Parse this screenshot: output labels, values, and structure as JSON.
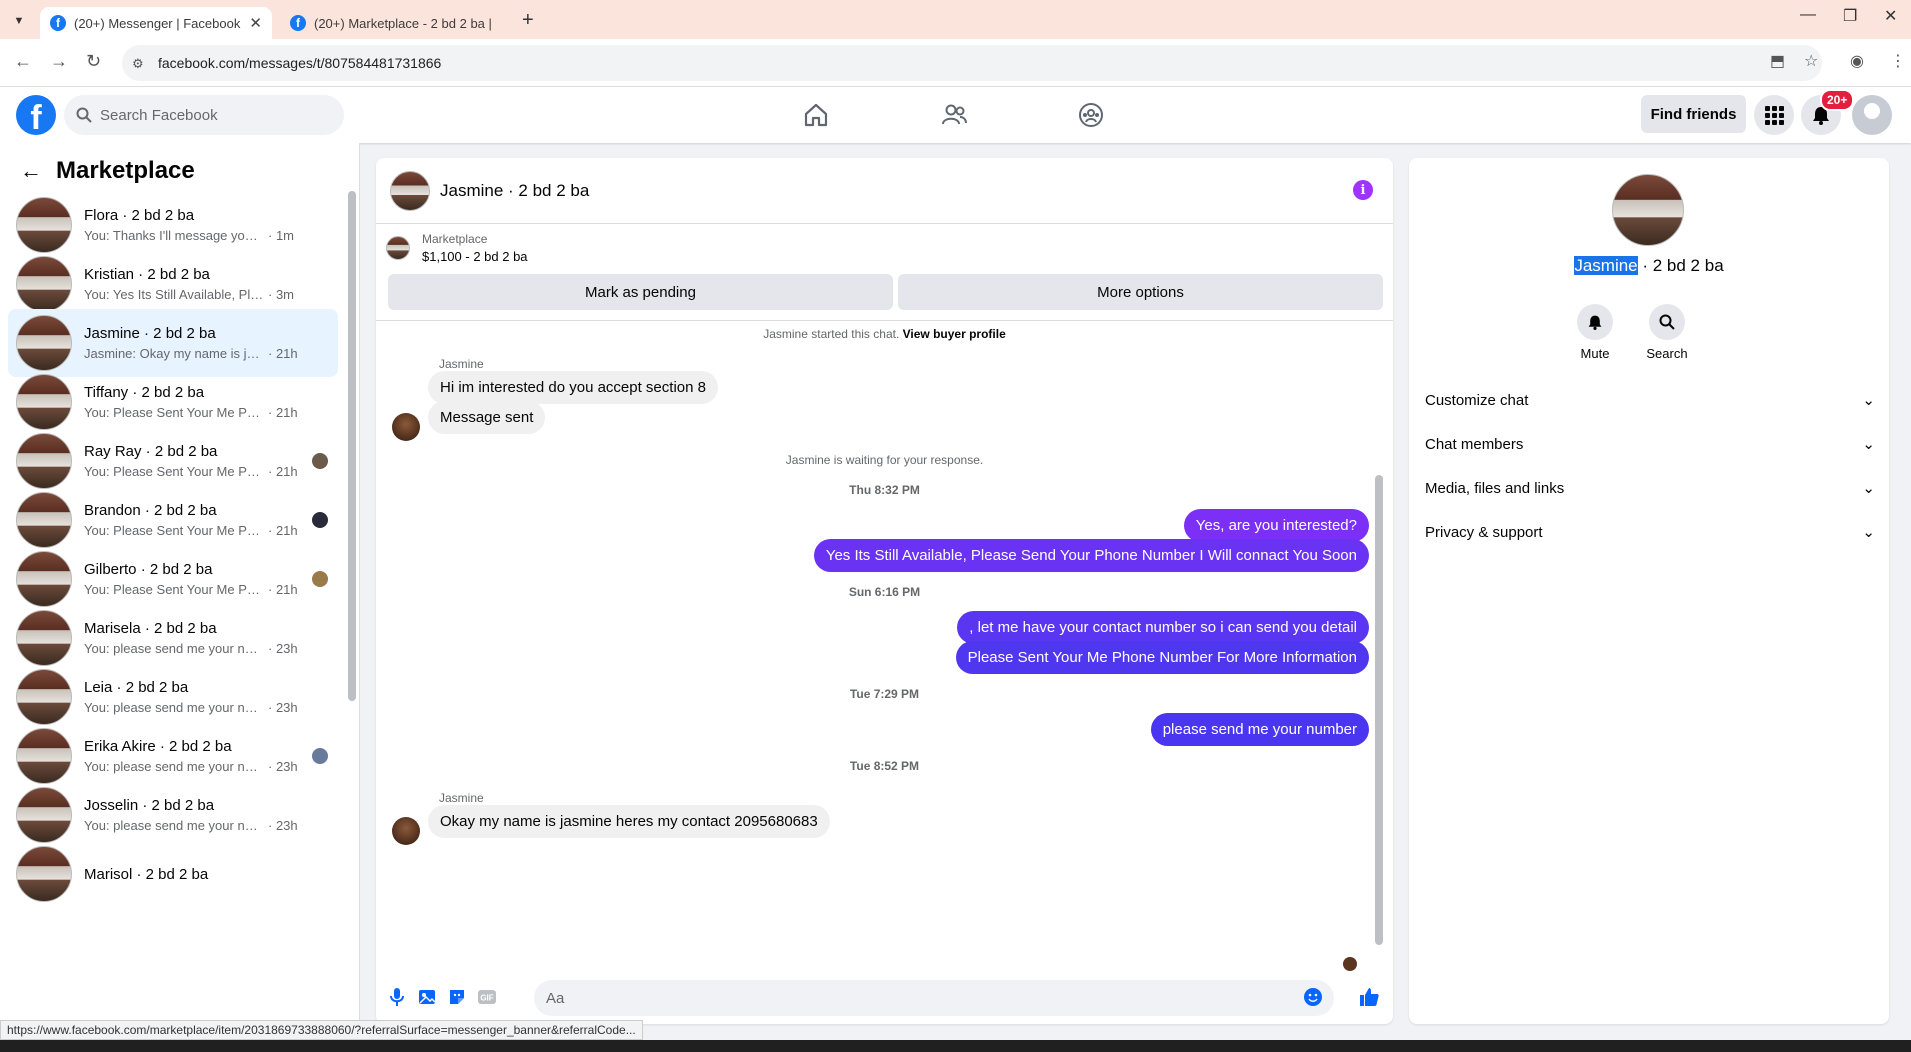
{
  "browser": {
    "tabs": [
      {
        "title": "(20+) Messenger | Facebook",
        "active": true
      },
      {
        "title": "(20+) Marketplace - 2 bd 2 ba |",
        "active": false
      }
    ],
    "url": "facebook.com/messages/t/807584481731866",
    "status_url": "https://www.facebook.com/marketplace/item/2031869733888060/?referralSurface=messenger_banner&referralCode..."
  },
  "header": {
    "logo": "f",
    "search_placeholder": "Search Facebook",
    "find_friends": "Find friends",
    "notifications_badge": "20+"
  },
  "sidebar": {
    "title": "Marketplace",
    "conversations": [
      {
        "name": "Flora · 2 bd 2 ba",
        "preview": "You: Thanks I'll message you in a ...",
        "time": "· 1m",
        "active": false
      },
      {
        "name": "Kristian · 2 bd 2 ba",
        "preview": "You: Yes Its Still Available, Please S...",
        "time": "· 3m",
        "active": false
      },
      {
        "name": "Jasmine · 2 bd 2 ba",
        "preview": "Jasmine: Okay my name is jasmin...",
        "time": "· 21h",
        "active": true
      },
      {
        "name": "Tiffany · 2 bd 2 ba",
        "preview": "You: Please Sent Your Me Phone ...",
        "time": "· 21h",
        "active": false
      },
      {
        "name": "Ray Ray · 2 bd 2 ba",
        "preview": "You: Please Sent Your Me Phon...",
        "time": "· 21h",
        "active": false
      },
      {
        "name": "Brandon · 2 bd 2 ba",
        "preview": "You: Please Sent Your Me Phon...",
        "time": "· 21h",
        "active": false
      },
      {
        "name": "Gilberto · 2 bd 2 ba",
        "preview": "You: Please Sent Your Me Phon...",
        "time": "· 21h",
        "active": false
      },
      {
        "name": "Marisela · 2 bd 2 ba",
        "preview": "You: please send me your number",
        "time": "· 23h",
        "active": false
      },
      {
        "name": "Leia · 2 bd 2 ba",
        "preview": "You: please send me your number",
        "time": "· 23h",
        "active": false
      },
      {
        "name": "Erika Akire · 2 bd 2 ba",
        "preview": "You: please send me your num...",
        "time": "· 23h",
        "active": false
      },
      {
        "name": "Josselin · 2 bd 2 ba",
        "preview": "You: please send me your number",
        "time": "· 23h",
        "active": false
      },
      {
        "name": "Marisol · 2 bd 2 ba",
        "preview": "",
        "time": "",
        "active": false
      }
    ]
  },
  "chat": {
    "title": "Jasmine · 2 bd 2 ba",
    "listing_label": "Marketplace",
    "listing_price": "$1,100 - 2 bd 2 ba",
    "mark_pending": "Mark as pending",
    "more_options": "More options",
    "started_text": "Jasmine started this chat.",
    "view_profile": "View buyer profile",
    "sender_name": "Jasmine",
    "msg_in_1": "Hi im interested do you accept section 8",
    "msg_in_2": "Message sent",
    "waiting_text": "Jasmine is waiting for your response.",
    "ts1": "Thu 8:32 PM",
    "msg_out_1": "Yes, are you interested?",
    "msg_out_2": "Yes Its Still Available, Please Send Your Phone Number I Will connact You Soon",
    "ts2": "Sun 6:16 PM",
    "msg_out_3": ", let me have your contact number so i can send you detail",
    "msg_out_4": "Please Sent Your Me Phone Number For More Information",
    "ts3": "Tue 7:29 PM",
    "msg_out_5": "please send me your number",
    "ts4": "Tue 8:52 PM",
    "msg_in_3": "Okay my name is jasmine heres my contact 2095680683",
    "input_placeholder": "Aa"
  },
  "details": {
    "name_highlight": "Jasmine",
    "name_rest": " · 2 bd 2 ba",
    "mute": "Mute",
    "search": "Search",
    "sections": [
      "Customize chat",
      "Chat members",
      "Media, files and links",
      "Privacy & support"
    ]
  },
  "colors": {
    "accent": "#1877f2",
    "bubble_purple": "#7b2ff7",
    "bubble_blue": "#4a36f0",
    "bubble_gray": "#f0f0f0"
  }
}
